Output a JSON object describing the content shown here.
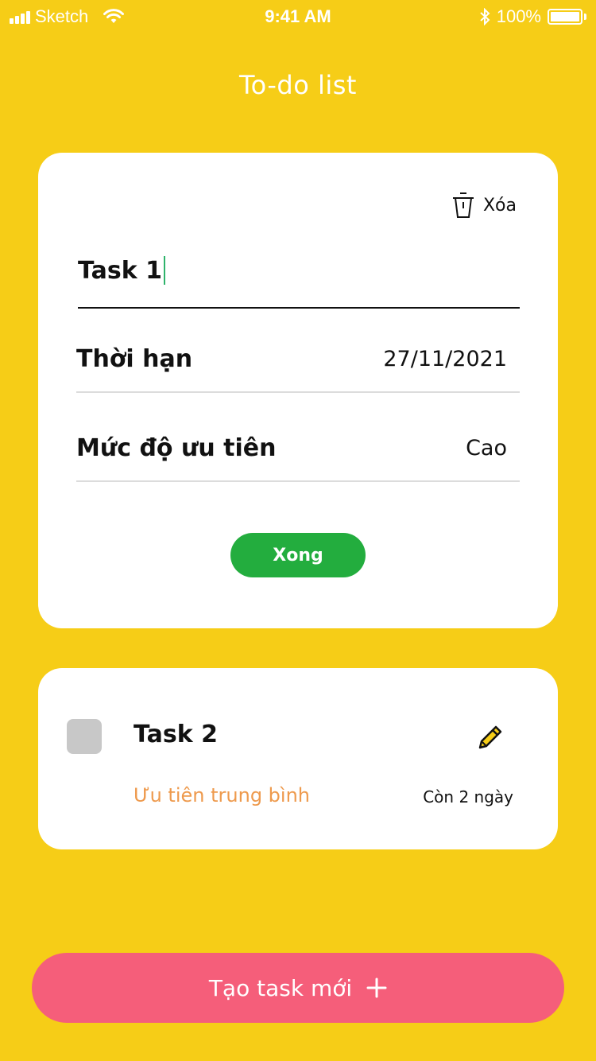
{
  "status_bar": {
    "carrier": "Sketch",
    "time": "9:41 AM",
    "battery": "100%"
  },
  "app": {
    "title": "To-do list"
  },
  "edit_card": {
    "delete_label": "Xóa",
    "task_name": "Task 1",
    "deadline_label": "Thời hạn",
    "deadline_value": "27/11/2021",
    "priority_label": "Mức độ ưu tiên",
    "priority_value": "Cao",
    "done_label": "Xong"
  },
  "tasks": [
    {
      "title": "Task 2",
      "priority": "Ưu tiên trung bình",
      "remaining": "Còn 2 ngày",
      "checked": false
    }
  ],
  "create_button": {
    "label": "Tạo task mới"
  },
  "colors": {
    "background": "#F6CD17",
    "done_button": "#23AD3E",
    "create_button": "#F55E7A",
    "priority_text": "#EE9A4D",
    "checkbox": "#C8C8C8",
    "caret": "#2EB36B"
  },
  "icons": {
    "wifi": "wifi-icon",
    "bluetooth": "bluetooth-icon",
    "battery": "battery-icon",
    "delete": "trash-icon",
    "edit": "pencil-icon",
    "add": "plus-icon"
  }
}
